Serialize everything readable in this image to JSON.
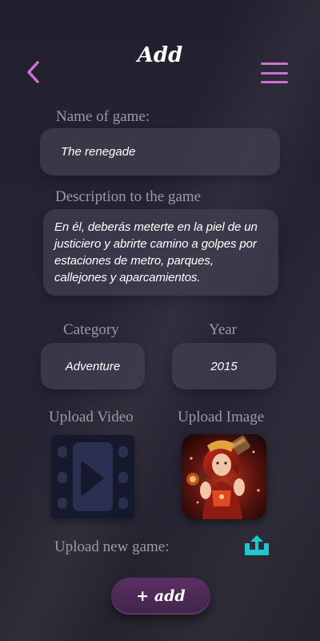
{
  "header": {
    "title": "Add",
    "back_icon": "chevron-left-icon",
    "menu_icon": "hamburger-menu-icon"
  },
  "form": {
    "name_label": "Name of game:",
    "name_value": "The renegade",
    "description_label": "Description to the game",
    "description_value": "En él, deberás meterte en la piel de un justiciero y abrirte camino a golpes por estaciones de metro, parques, callejones y aparcamientos.",
    "category_label": "Category",
    "category_value": "Adventure",
    "year_label": "Year",
    "year_value": "2015",
    "upload_video_label": "Upload Video",
    "upload_image_label": "Upload Image",
    "upload_new_game_label": "Upload new game:"
  },
  "icons": {
    "video": "film-strip-play-icon",
    "image": "game-character-thumbnail",
    "upload": "upload-icon"
  },
  "add_button_label": "+ add",
  "colors": {
    "accent": "#d36fcf",
    "upload_icon": "#1ec8cf",
    "button": "#4c2956",
    "label": "#9c9aa6",
    "field": "#3a3848"
  }
}
